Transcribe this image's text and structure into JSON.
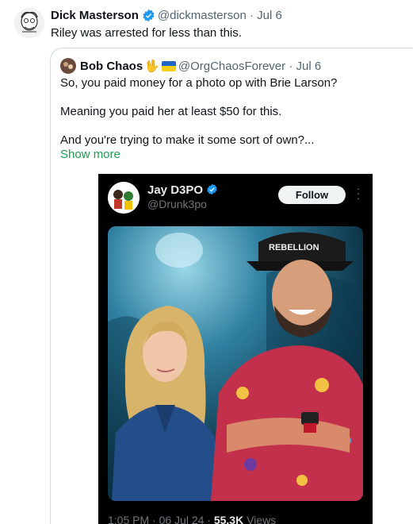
{
  "tweet": {
    "author_name": "Dick Masterson",
    "handle": "@dickmasterson",
    "separator": "·",
    "date": "Jul 6",
    "text": "Riley was arrested for less than this."
  },
  "quoted_tweet": {
    "author_name": "Bob Chaos",
    "emoji": "🖖",
    "handle": "@OrgChaosForever",
    "separator": "·",
    "date": "Jul 6",
    "lines": [
      "So, you paid money for a photo op with Brie Larson?",
      "Meaning you paid her at least $50 for this.",
      "And you're trying to make it some sort of own?..."
    ],
    "show_more": "Show more"
  },
  "embedded_screenshot": {
    "name": "Jay D3PO",
    "handle": "@Drunk3po",
    "follow_label": "Follow",
    "more_icon": "more-dots-icon",
    "hat_text": "REBELLION",
    "footer_time": "1:05 PM · 06 Jul 24 · ",
    "footer_views_count": "55.3K",
    "footer_views_label": " Views"
  },
  "colors": {
    "verified_blue": "#1d9bf0",
    "show_more_green": "#1d9b4f",
    "handle_gray": "#536471",
    "border": "#cfd9de"
  }
}
